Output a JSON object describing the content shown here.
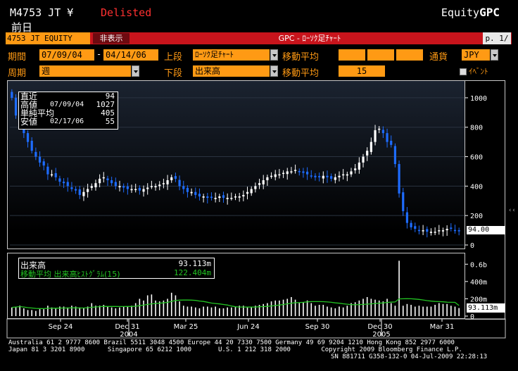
{
  "header": {
    "ticker": "M4753 JT ¥",
    "status": "Delisted",
    "brand_prefix": "Equity",
    "brand_suffix": "GPC",
    "subtitle": "前日"
  },
  "bar": {
    "security": "4753 JT EQUITY",
    "hide_button": "非表示",
    "title": "GPC - ﾛｰｿｸ足ﾁｬｰﾄ",
    "page": "p. 1/"
  },
  "params": {
    "period_label": "期間",
    "start_date": "07/09/04",
    "dash": "-",
    "end_date": "04/14/06",
    "upper_label": "上段",
    "upper_value": "ﾛｰｿｸ足ﾁｬｰﾄ",
    "ma_label": "移動平均",
    "currency_label": "通貨",
    "currency_value": "JPY",
    "freq_label": "周期",
    "freq_value": "週",
    "lower_label": "下段",
    "lower_value": "出来高",
    "ma_label2": "移動平均",
    "ma_value": "15",
    "event_label": "ｲﾍﾞﾝﾄ"
  },
  "infobox": [
    {
      "key": "直近",
      "date": "",
      "value": "94"
    },
    {
      "key": "高値",
      "date": "07/09/04",
      "value": "1027"
    },
    {
      "key": "単純平均",
      "date": "",
      "value": "405"
    },
    {
      "key": "安値",
      "date": "02/17/06",
      "value": "55"
    }
  ],
  "volume_legend": {
    "row1_label": "出来高",
    "row1_value": "93.113m",
    "row2_label": "移動平均 出来高ﾋｽﾄｸﾞﾗﾑ(15)",
    "row2_value": "122.404m"
  },
  "axis": {
    "price_ticks": [
      "1000",
      "800",
      "600",
      "400",
      "200",
      "0"
    ],
    "last_price_label": "94.00",
    "vol_ticks": [
      "0.6b",
      "400m",
      "200m",
      "0"
    ],
    "last_vol_label": "93.113m",
    "x_ticks": [
      "Sep 24",
      "Dec 31",
      "Mar 25",
      "Jun 24",
      "Sep 30",
      "Dec 30",
      "Mar 31"
    ],
    "x_years": [
      "2004",
      "2005"
    ]
  },
  "colors": {
    "up_candle": "#ffffff",
    "down_candle": "#1e6cff",
    "ma_line": "#22c422",
    "accent": "#ff9a14",
    "status": "#ff3030"
  },
  "chart_data": {
    "type": "candlestick",
    "frequency": "weekly",
    "ylim": [
      0,
      1100
    ],
    "price_close": [
      1000,
      880,
      820,
      760,
      700,
      640,
      600,
      560,
      540,
      480,
      480,
      460,
      430,
      420,
      400,
      380,
      370,
      340,
      360,
      380,
      400,
      420,
      450,
      460,
      440,
      420,
      400,
      400,
      390,
      380,
      380,
      380,
      370,
      380,
      390,
      400,
      400,
      410,
      420,
      440,
      460,
      450,
      400,
      380,
      360,
      360,
      340,
      330,
      330,
      320,
      320,
      320,
      330,
      320,
      320,
      320,
      330,
      330,
      340,
      360,
      380,
      400,
      420,
      440,
      460,
      470,
      480,
      480,
      490,
      500,
      500,
      510,
      500,
      490,
      480,
      470,
      460,
      460,
      470,
      460,
      450,
      460,
      470,
      480,
      480,
      500,
      520,
      560,
      600,
      640,
      700,
      780,
      790,
      760,
      700,
      680,
      550,
      350,
      230,
      150,
      120,
      110,
      100,
      100,
      90,
      90,
      90,
      100,
      100,
      110,
      110,
      100,
      94
    ],
    "volume_ma_last": 122.404,
    "volume_last": 93.113,
    "volume_spike": 0.64,
    "volume": [
      100,
      110,
      120,
      90,
      70,
      70,
      60,
      80,
      80,
      120,
      100,
      90,
      110,
      110,
      100,
      120,
      110,
      100,
      90,
      110,
      150,
      120,
      120,
      130,
      110,
      100,
      90,
      100,
      110,
      110,
      120,
      150,
      200,
      180,
      240,
      250,
      180,
      170,
      180,
      200,
      270,
      240,
      170,
      120,
      110,
      110,
      100,
      90,
      110,
      110,
      100,
      110,
      90,
      90,
      100,
      100,
      110,
      120,
      120,
      100,
      110,
      120,
      130,
      140,
      150,
      170,
      180,
      180,
      190,
      200,
      220,
      190,
      150,
      160,
      180,
      150,
      120,
      130,
      130,
      110,
      100,
      90,
      110,
      100,
      120,
      150,
      160,
      180,
      200,
      220,
      200,
      190,
      180,
      170,
      200,
      150,
      120,
      640,
      120,
      140,
      130,
      110,
      120,
      110,
      110,
      110,
      130,
      150,
      140,
      140,
      120,
      110,
      93
    ]
  }
}
